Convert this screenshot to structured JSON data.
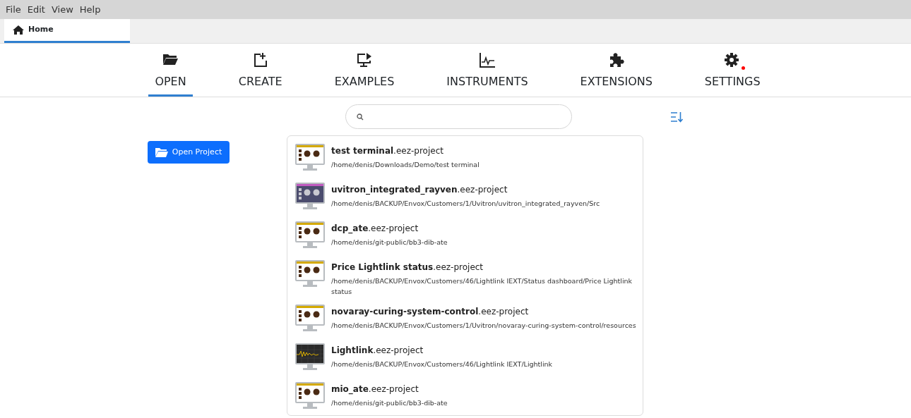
{
  "menu": [
    "File",
    "Edit",
    "View",
    "Help"
  ],
  "tabs": [
    {
      "label": "Home",
      "selected": true
    }
  ],
  "nav": [
    {
      "label": "OPEN",
      "kind": "folder",
      "selected": true,
      "notification": false
    },
    {
      "label": "CREATE",
      "kind": "create",
      "selected": false,
      "notification": false
    },
    {
      "label": "EXAMPLES",
      "kind": "examples",
      "selected": false,
      "notification": false
    },
    {
      "label": "INSTRUMENTS",
      "kind": "chart",
      "selected": false,
      "notification": false
    },
    {
      "label": "EXTENSIONS",
      "kind": "puzzle",
      "selected": false,
      "notification": false
    },
    {
      "label": "SETTINGS",
      "kind": "gear",
      "selected": false,
      "notification": true
    }
  ],
  "open_button": {
    "label": "Open Project"
  },
  "projects": [
    {
      "kind": "light",
      "title": "**test terminal**.eez-project",
      "path": "/home/denis/Downloads/Demo/test terminal"
    },
    {
      "kind": "dark",
      "title": "**uvitron_integrated_rayven**.eez-project",
      "path": "/home/denis/BACKUP/Envox/Customers/1/Uvitron/uvitron_integrated_rayven/Src"
    },
    {
      "kind": "light",
      "title": "**dcp_ate**.eez-project",
      "path": "/home/denis/git-public/bb3-dib-ate"
    },
    {
      "kind": "light",
      "title": "**Price Lightlink status**.eez-project",
      "path": "/home/denis/BACKUP/Envox/Customers/46/Lightlink IEXT/Status dashboard/Price Lightlink status"
    },
    {
      "kind": "light",
      "title": "**novaray-curing-system-control**.eez-project",
      "path": "/home/denis/BACKUP/Envox/Customers/1/Uvitron/novaray-curing-system-control/resources"
    },
    {
      "kind": "scope",
      "title": "**Lightlink**.eez-project",
      "path": "/home/denis/BACKUP/Envox/Customers/46/Lightlink IEXT/Lightlink"
    },
    {
      "kind": "light",
      "title": "**mio_ate**.eez-project",
      "path": "/home/denis/git-public/bb3-dib-ate"
    }
  ]
}
